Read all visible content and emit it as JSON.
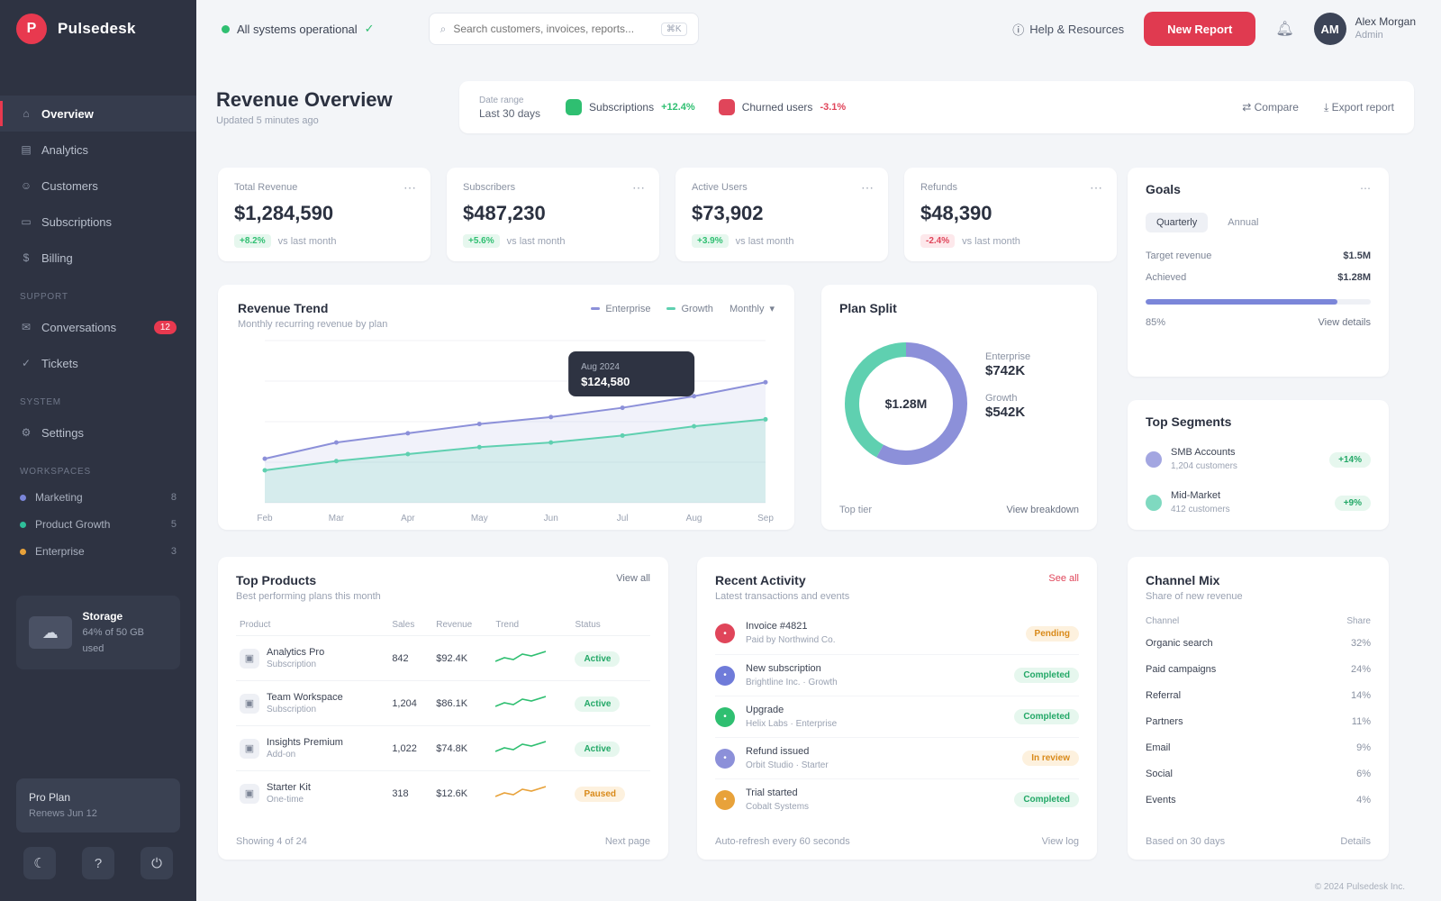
{
  "brand": {
    "name": "Pulsedesk",
    "logo_letter": "P"
  },
  "sidebar": {
    "items": [
      {
        "label": "Overview",
        "icon": "home-icon",
        "glyph": "⌂",
        "active": true
      },
      {
        "label": "Analytics",
        "icon": "chart-icon",
        "glyph": "▤"
      },
      {
        "label": "Customers",
        "icon": "users-icon",
        "glyph": "☺"
      },
      {
        "label": "Subscriptions",
        "icon": "card-icon",
        "glyph": "▭"
      },
      {
        "label": "Billing",
        "icon": "wallet-icon",
        "glyph": "$"
      }
    ],
    "support_section": "Support",
    "support_items": [
      {
        "label": "Conversations",
        "icon": "chat-icon",
        "glyph": "✉",
        "count": "12"
      },
      {
        "label": "Tickets",
        "icon": "ticket-icon",
        "glyph": "✓"
      }
    ],
    "settings_section": "System",
    "settings_items": [
      {
        "label": "Settings",
        "icon": "gear-icon",
        "glyph": "⚙"
      }
    ],
    "workspace_section": "Workspaces",
    "workspaces": [
      {
        "label": "Marketing",
        "n": "8",
        "color": "#7b86d9"
      },
      {
        "label": "Product Growth",
        "n": "5",
        "color": "#2fbf9a"
      },
      {
        "label": "Enterprise",
        "n": "3",
        "color": "#e8a23a"
      }
    ],
    "storage": {
      "title": "Storage",
      "detail": "64% of 50 GB used"
    },
    "plan": {
      "title": "Pro Plan",
      "detail": "Renews Jun 12"
    }
  },
  "topbar": {
    "status": "All systems operational",
    "search_placeholder": "Search customers, invoices, reports...",
    "search_kbd": "⌘K",
    "help": "Help & Resources",
    "cta": "New Report",
    "user_name": "Alex Morgan",
    "user_role": "Admin",
    "user_initials": "AM"
  },
  "header": {
    "title": "Revenue Overview",
    "subtitle": "Updated 5 minutes ago",
    "date_label": "Date range",
    "date_value": "Last 30 days",
    "chips": [
      {
        "label": "Subscriptions",
        "delta": "+12.4%",
        "color": "#2fbf71",
        "delta_color": "#2fbf71"
      },
      {
        "label": "Churned users",
        "delta": "-3.1%",
        "color": "#e0455a",
        "delta_color": "#e0455a"
      }
    ],
    "compare": "Compare",
    "export": "Export report"
  },
  "kpis": [
    {
      "label": "Total Revenue",
      "value": "$1,284,590",
      "change": "+8.2%",
      "dir": "up",
      "note": "vs last month"
    },
    {
      "label": "Subscribers",
      "value": "$487,230",
      "change": "+5.6%",
      "dir": "up",
      "note": "vs last month"
    },
    {
      "label": "Active Users",
      "value": "$73,902",
      "change": "+3.9%",
      "dir": "up",
      "note": "vs last month"
    },
    {
      "label": "Refunds",
      "value": "$48,390",
      "change": "-2.4%",
      "dir": "down",
      "note": "vs last month"
    }
  ],
  "revenue_chart": {
    "title": "Revenue Trend",
    "subtitle": "Monthly recurring revenue by plan",
    "legend": [
      {
        "name": "Enterprise",
        "color": "#8c90d9"
      },
      {
        "name": "Growth",
        "color": "#5fd0b0"
      }
    ],
    "range": "Monthly",
    "tooltip_title": "Aug 2024",
    "tooltip_value": "$124,580"
  },
  "chart_data": {
    "type": "area",
    "x": [
      "Feb",
      "Mar",
      "Apr",
      "May",
      "Jun",
      "Jul",
      "Aug",
      "Sep"
    ],
    "series": [
      {
        "name": "Enterprise",
        "values": [
          38,
          52,
          60,
          68,
          74,
          82,
          92,
          104
        ]
      },
      {
        "name": "Growth",
        "values": [
          28,
          36,
          42,
          48,
          52,
          58,
          66,
          72
        ]
      }
    ],
    "ylim": [
      0,
      140
    ]
  },
  "plan_split": {
    "title": "Plan Split",
    "center": "$1.28M",
    "items": [
      {
        "label": "Enterprise",
        "value": "$742K"
      },
      {
        "label": "Growth",
        "value": "$542K"
      }
    ],
    "shares": [
      58,
      42
    ],
    "colors": [
      "#8c90d9",
      "#5fd0b0"
    ],
    "footer_left": "Top tier",
    "footer_right": "View breakdown"
  },
  "goals": {
    "title": "Goals",
    "tabs": [
      "Quarterly",
      "Annual"
    ],
    "rows": [
      {
        "label": "Target revenue",
        "value": "$1.5M"
      },
      {
        "label": "Achieved",
        "value": "$1.28M"
      }
    ],
    "progress": 0.85,
    "progress_label": "85%",
    "link": "View details"
  },
  "top_segments": {
    "title": "Top Segments",
    "items": [
      {
        "label": "SMB Accounts",
        "sub": "1,204 customers",
        "tag": "+14%",
        "color": "#8c90d9"
      },
      {
        "label": "Mid-Market",
        "sub": "412 customers",
        "tag": "+9%",
        "color": "#5fd0b0"
      }
    ]
  },
  "top_products": {
    "title": "Top Products",
    "subtitle": "Best performing plans this month",
    "link": "View all",
    "headers": [
      "Product",
      "Sales",
      "Revenue",
      "Trend",
      "Status"
    ],
    "rows": [
      {
        "name": "Analytics Pro",
        "sub": "Subscription",
        "sales": "842",
        "revenue": "$92.4K",
        "status": "Active",
        "tag": "green"
      },
      {
        "name": "Team Workspace",
        "sub": "Subscription",
        "sales": "1,204",
        "revenue": "$86.1K",
        "status": "Active",
        "tag": "green"
      },
      {
        "name": "Insights Premium",
        "sub": "Add-on",
        "sales": "1,022",
        "revenue": "$74.8K",
        "status": "Active",
        "tag": "green"
      },
      {
        "name": "Starter Kit",
        "sub": "One-time",
        "sales": "318",
        "revenue": "$12.6K",
        "status": "Paused",
        "tag": "amber"
      }
    ],
    "footer": "Showing 4 of 24",
    "footer_right": "Next page"
  },
  "activity": {
    "title": "Recent Activity",
    "subtitle": "Latest transactions and events",
    "link": "See all",
    "rows": [
      {
        "text": "Invoice #4821",
        "sub": "Paid by Northwind Co.",
        "tag": "Pending",
        "kind": "amber",
        "color": "#e0455a"
      },
      {
        "text": "New subscription",
        "sub": "Brightline Inc. · Growth",
        "tag": "Completed",
        "kind": "green",
        "color": "#6f7bd9"
      },
      {
        "text": "Upgrade",
        "sub": "Helix Labs · Enterprise",
        "tag": "Completed",
        "kind": "green",
        "color": "#2fbf71"
      },
      {
        "text": "Refund issued",
        "sub": "Orbit Studio · Starter",
        "tag": "In review",
        "kind": "amber",
        "color": "#8c90d9"
      },
      {
        "text": "Trial started",
        "sub": "Cobalt Systems",
        "tag": "Completed",
        "kind": "green",
        "color": "#e8a23a"
      }
    ],
    "footer": "Auto-refresh every 60 seconds",
    "footer_right": "View log"
  },
  "channels": {
    "title": "Channel Mix",
    "subtitle": "Share of new revenue",
    "headers": [
      "Channel",
      "Share"
    ],
    "rows": [
      {
        "label": "Organic search",
        "value": "32%"
      },
      {
        "label": "Paid campaigns",
        "value": "24%"
      },
      {
        "label": "Referral",
        "value": "14%"
      },
      {
        "label": "Partners",
        "value": "11%"
      },
      {
        "label": "Email",
        "value": "9%"
      },
      {
        "label": "Social",
        "value": "6%"
      },
      {
        "label": "Events",
        "value": "4%"
      }
    ],
    "footer": "Based on 30 days",
    "footer_right": "Details"
  },
  "footnote": "© 2024 Pulsedesk Inc."
}
